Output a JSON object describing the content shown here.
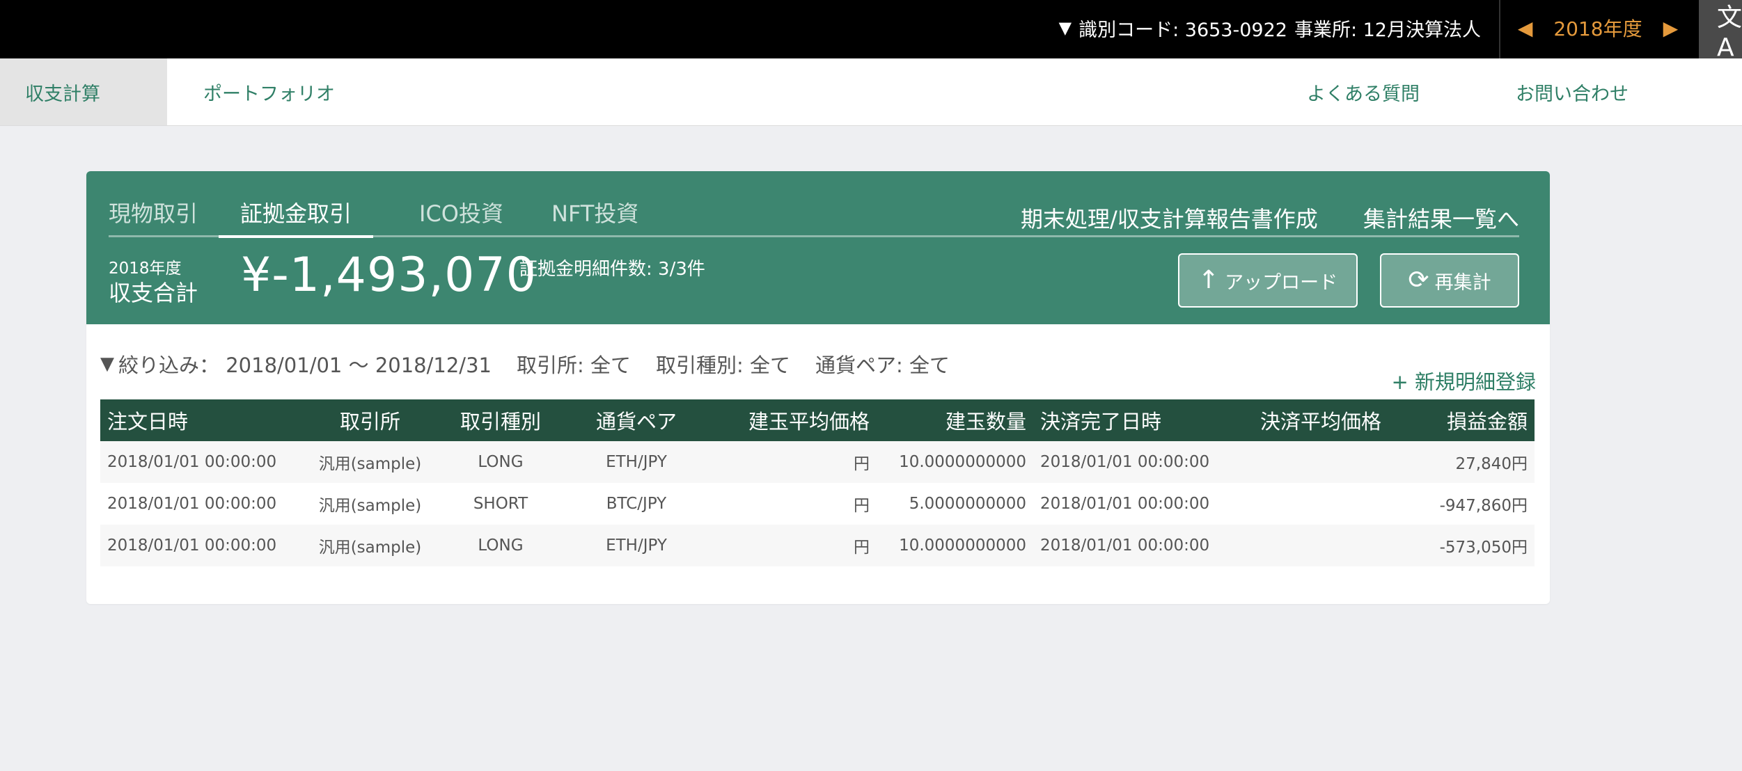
{
  "topbar": {
    "ident_marker": "▼",
    "ident_code": "識別コード: 3653-0922",
    "office": "事業所: 12月決算法人",
    "year": "2018年度",
    "prev_arrow": "◀",
    "next_arrow": "▶",
    "translate_glyph": "文A"
  },
  "nav": {
    "items": [
      "収支計算",
      "ポートフォリオ"
    ],
    "right_items": [
      "よくある質問",
      "お問い合わせ"
    ]
  },
  "card": {
    "tabs": [
      "現物取引",
      "証拠金取引",
      "ICO投資",
      "NFT投資"
    ],
    "active_tab": "証拠金取引",
    "links": [
      "期末処理/収支計算報告書作成",
      "集計結果一覧へ"
    ],
    "total_year": "2018年度",
    "total_label": "収支合計",
    "total_value": "¥-1,493,070",
    "count_text": "証拠金明細件数: 3/3件",
    "upload_label": "アップロード",
    "upload_icon": "↑",
    "recalc_label": "再集計",
    "recalc_icon": "⟳"
  },
  "filter": {
    "label": "絞り込み：",
    "period": "2018/01/01 〜 2018/12/31",
    "exchange": "取引所: 全て",
    "trade_type": "取引種別: 全て",
    "pair": "通貨ペア: 全て",
    "funnel_icon": "▼"
  },
  "new_link": "+ 新規明細登録",
  "table": {
    "headers": [
      "注文日時",
      "取引所",
      "取引種別",
      "通貨ペア",
      "建玉平均価格",
      "建玉数量",
      "決済完了日時",
      "決済平均価格",
      "損益金額"
    ],
    "rows": [
      [
        "2018/01/01 00:00:00",
        "汎用(sample)",
        "LONG",
        "ETH/JPY",
        "円",
        "10.0000000000",
        "2018/01/01 00:00:00",
        "",
        "27,840円"
      ],
      [
        "2018/01/01 00:00:00",
        "汎用(sample)",
        "SHORT",
        "BTC/JPY",
        "円",
        "5.0000000000",
        "2018/01/01 00:00:00",
        "",
        "-947,860円"
      ],
      [
        "2018/01/01 00:00:00",
        "汎用(sample)",
        "LONG",
        "ETH/JPY",
        "円",
        "10.0000000000",
        "2018/01/01 00:00:00",
        "",
        "-573,050円"
      ]
    ]
  }
}
